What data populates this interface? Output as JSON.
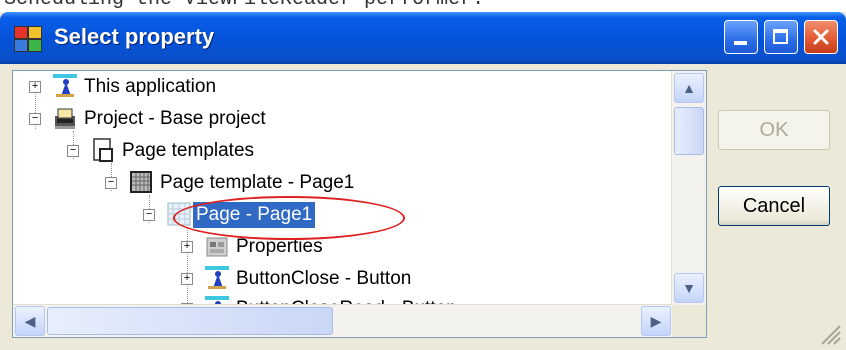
{
  "caption": "Scheduling the ViewFileReader performer.",
  "window": {
    "title": "Select property"
  },
  "tree": {
    "nodes": [
      {
        "label": "This application",
        "expander": "+",
        "icon": "application-icon"
      },
      {
        "label": "Project - Base project",
        "expander": "−",
        "icon": "project-icon"
      },
      {
        "label": "Page templates",
        "expander": "−",
        "icon": "page-templates-icon"
      },
      {
        "label": "Page template - Page1",
        "expander": "−",
        "icon": "page-template-icon"
      },
      {
        "label": "Page - Page1",
        "expander": "−",
        "icon": "page-icon",
        "selected": true
      },
      {
        "label": "Properties",
        "expander": "+",
        "icon": "properties-icon"
      },
      {
        "label": "ButtonClose - Button",
        "expander": "+",
        "icon": "button-component-icon"
      },
      {
        "label": "ButtonCloseRead - Button",
        "expander": "+",
        "icon": "button-component-icon"
      }
    ]
  },
  "buttons": {
    "ok": "OK",
    "cancel": "Cancel"
  },
  "colors": {
    "selection": "#316ac5",
    "annotation": "#dd2222",
    "titlebar": "#0453d9"
  }
}
